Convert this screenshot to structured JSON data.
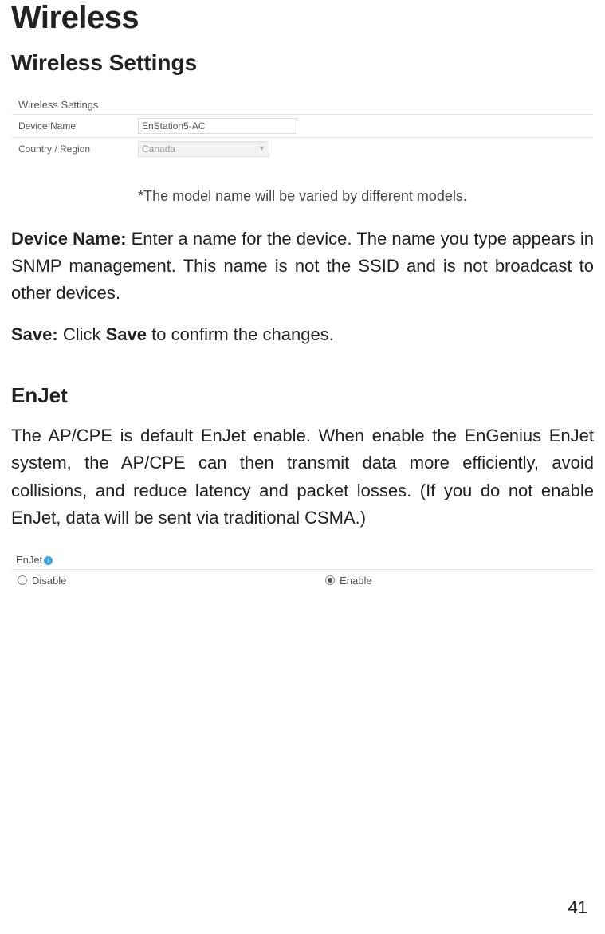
{
  "heading": "Wireless",
  "subheading": "Wireless Settings",
  "screenshot1": {
    "header": "Wireless Settings",
    "rows": [
      {
        "label": "Device Name",
        "value": "EnStation5-AC",
        "type": "text"
      },
      {
        "label": "Country / Region",
        "value": "Canada",
        "type": "select"
      }
    ]
  },
  "footnote": "*The model name will be varied by different models.",
  "para1": {
    "label": "Device Name:",
    "text": " Enter a name for the device. The name you type appears in SNMP management. This name is not the SSID and is not broadcast to other devices."
  },
  "para2": {
    "label": "Save:",
    "pre": " Click ",
    "bold": "Save",
    "post": " to confirm the changes."
  },
  "section2_heading": "EnJet",
  "para3": "The AP/CPE is default EnJet enable. When enable the EnGenius EnJet system, the AP/CPE can then transmit data more efficiently, avoid collisions, and reduce latency and packet losses. (If you do not enable EnJet, data will be sent via traditional CSMA.)",
  "screenshot2": {
    "header": "EnJet",
    "options": [
      {
        "label": "Disable",
        "checked": false
      },
      {
        "label": "Enable",
        "checked": true
      }
    ]
  },
  "page_number": "41"
}
